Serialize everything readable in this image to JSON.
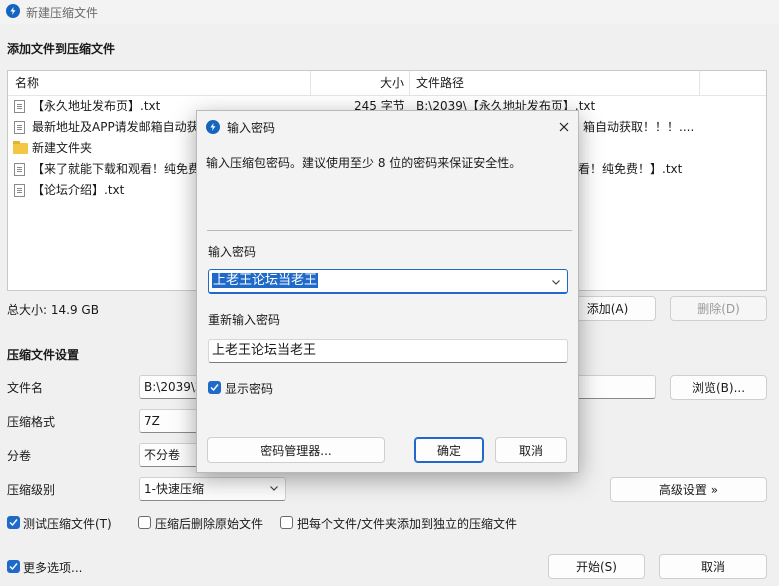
{
  "window": {
    "title": "新建压缩文件"
  },
  "files_section": {
    "label": "添加文件到压缩文件",
    "columns": {
      "name": "名称",
      "size": "大小",
      "path": "文件路径"
    },
    "rows": [
      {
        "icon": "file-icon",
        "name": "【永久地址发布页】.txt",
        "size": "245 字节",
        "path": "B:\\2039\\【永久地址发布页】.txt"
      },
      {
        "icon": "file-icon",
        "name": "最新地址及APP请发邮箱自动获",
        "size": "",
        "path": "箱自动获取！！！...."
      },
      {
        "icon": "folder-icon",
        "name": "新建文件夹",
        "size": "",
        "path": ""
      },
      {
        "icon": "file-icon",
        "name": "【来了就能下载和观看！纯免费",
        "size": "",
        "path": "看！纯免费！】.txt"
      },
      {
        "icon": "file-icon",
        "name": "【论坛介绍】.txt",
        "size": "",
        "path": ""
      }
    ],
    "total_size": "总大小: 14.9 GB",
    "add_button": "添加(A)",
    "delete_button": "删除(D)"
  },
  "settings": {
    "label": "压缩文件设置",
    "filename_label": "文件名",
    "filename_value": "B:\\2039\\2",
    "browse_button": "浏览(B)...",
    "format_label": "压缩格式",
    "format_value": "7Z",
    "split_label": "分卷",
    "split_value": "不分卷",
    "level_label": "压缩级别",
    "level_value": "1-快速压缩",
    "advanced_button": "高级设置 »"
  },
  "options": {
    "test_label": "测试压缩文件(T)",
    "test_checked": true,
    "delete_after_label": "压缩后删除原始文件",
    "delete_after_checked": false,
    "separate_label": "把每个文件/文件夹添加到独立的压缩文件",
    "separate_checked": false,
    "more_label": "更多选项...",
    "more_checked": true
  },
  "footer": {
    "start_button": "开始(S)",
    "cancel_button": "取消"
  },
  "dialog": {
    "title": "输入密码",
    "description": "输入压缩包密码。建议使用至少 8 位的密码来保证安全性。",
    "password_label": "输入密码",
    "password_value": "上老王论坛当老王",
    "confirm_label": "重新输入密码",
    "confirm_value": "上老王论坛当老王",
    "show_password_label": "显示密码",
    "show_password_checked": true,
    "manager_button": "密码管理器...",
    "ok_button": "确定",
    "cancel_button": "取消",
    "close_icon": "close-icon"
  },
  "colors": {
    "accent": "#1f6ac9",
    "app_icon": "#1565c0",
    "folder": "#f3c744"
  }
}
